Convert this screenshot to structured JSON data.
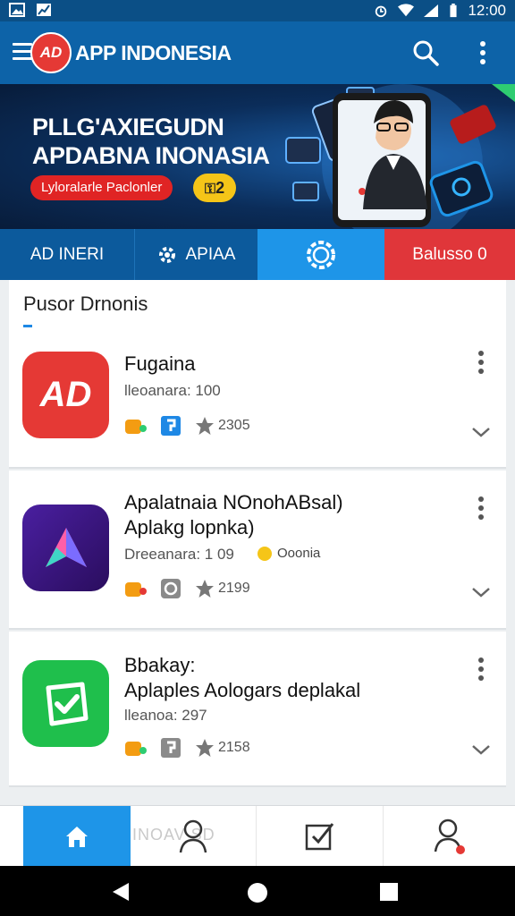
{
  "status_bar": {
    "time": "12:00"
  },
  "app_bar": {
    "logo_text": "AD",
    "title": "APP INDONESIA"
  },
  "banner": {
    "title_line1": "PLLG'AXIEGUDN",
    "title_line2": "APDABNA INONASIA",
    "button_label": "Lyloralarle Paclonler",
    "badge": "2"
  },
  "tabs": [
    {
      "label": "AD INERI"
    },
    {
      "label": "APIAA"
    },
    {
      "label": ""
    },
    {
      "label": "Balusso 0"
    }
  ],
  "section": {
    "title": "Pusor Drnonis"
  },
  "apps": [
    {
      "name": "Fugaina",
      "meta": "lleoanara: 100",
      "icon_text": "AD",
      "rating": "2305",
      "accent": "#e53935"
    },
    {
      "name_line1": "Apalatnaia NOnohABsal)",
      "name_line2": "Aplakg lopnka)",
      "meta": "Dreeanara: 1 09",
      "extra": "Ooonia",
      "rating": "2199",
      "accent": "#3a1a8a"
    },
    {
      "name_line1": "Bbakay:",
      "name_line2": "Aplaples Aologars deplakal",
      "meta": "lleanoa: 297",
      "rating": "2158",
      "accent": "#1fbf4c"
    }
  ],
  "bottom_nav": {
    "ghost_text": "INOAV  SD"
  },
  "colors": {
    "primary": "#0d63a8",
    "accent_blue": "#1e95e8",
    "accent_red": "#e0363a"
  }
}
